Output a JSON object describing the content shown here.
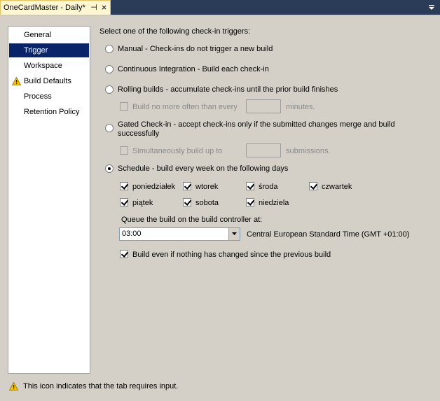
{
  "tab": {
    "title": "OneCardMaster - Daily*",
    "pin_glyph": "⊣",
    "close_glyph": "×"
  },
  "nav": {
    "items": [
      {
        "label": "General",
        "selected": false,
        "warning": false
      },
      {
        "label": "Trigger",
        "selected": true,
        "warning": false
      },
      {
        "label": "Workspace",
        "selected": false,
        "warning": false
      },
      {
        "label": "Build Defaults",
        "selected": false,
        "warning": true
      },
      {
        "label": "Process",
        "selected": false,
        "warning": false
      },
      {
        "label": "Retention Policy",
        "selected": false,
        "warning": false
      }
    ]
  },
  "trigger": {
    "heading": "Select one of the following check-in triggers:",
    "manual": "Manual - Check-ins do not trigger a new build",
    "ci": "Continuous Integration - Build each check-in",
    "rolling": "Rolling builds - accumulate check-ins until the prior build finishes",
    "rolling_sub": "Build no more often than every",
    "rolling_value": "",
    "rolling_unit": "minutes.",
    "gated_line1": "Gated Check-in - accept check-ins only if the submitted changes merge and build",
    "gated_line2": "successfully",
    "gated_sub": "Simultaneously build up to",
    "gated_value": "",
    "gated_unit": "submissions.",
    "schedule": "Schedule - build every week on the following days",
    "selected": "schedule",
    "days": [
      {
        "label": "poniedziałek",
        "checked": true
      },
      {
        "label": "wtorek",
        "checked": true
      },
      {
        "label": "środa",
        "checked": true
      },
      {
        "label": "czwartek",
        "checked": true
      },
      {
        "label": "piątek",
        "checked": true
      },
      {
        "label": "sobota",
        "checked": true
      },
      {
        "label": "niedziela",
        "checked": true
      }
    ],
    "queue_label": "Queue the build on the build controller at:",
    "time": "03:00",
    "timezone": "Central European Standard Time (GMT +01:00)",
    "build_even": "Build even if nothing has changed since the previous build",
    "build_even_checked": true
  },
  "footer": {
    "text": "This icon indicates that the tab requires input."
  },
  "colors": {
    "tab_strip": "#2b3c59",
    "tab_active": "#fff7d1",
    "selection": "#0a246a",
    "warning": "#f5c400"
  }
}
